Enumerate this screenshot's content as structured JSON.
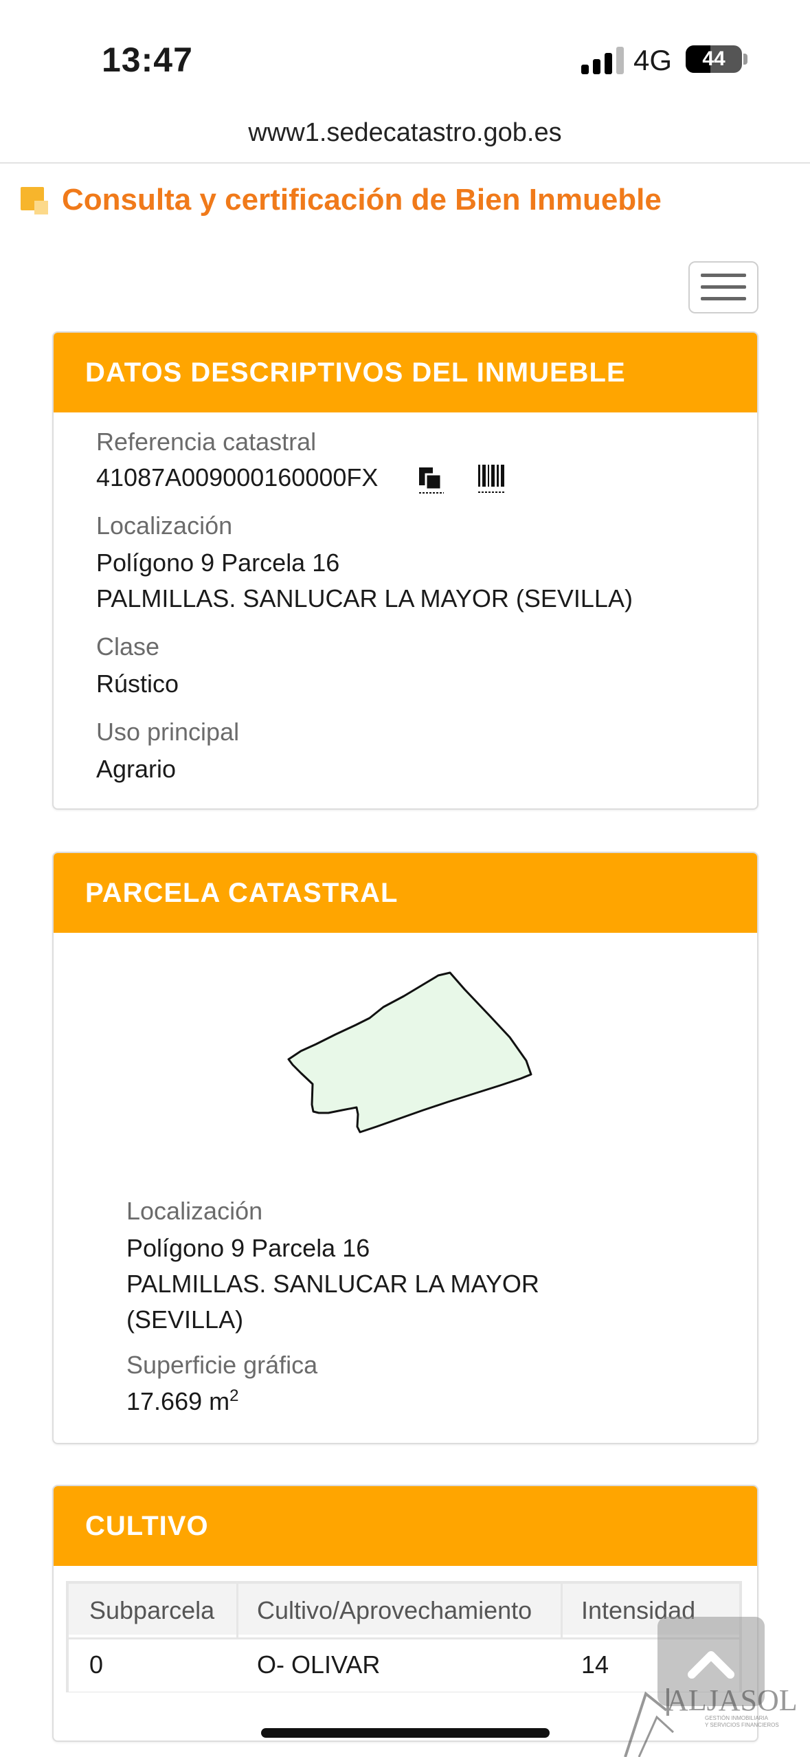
{
  "status": {
    "time": "13:47",
    "network": "4G",
    "battery": "44",
    "battery_level": 0.44
  },
  "browser": {
    "url": "www1.sedecatastro.gob.es"
  },
  "header": {
    "title": "Consulta y certificación de Bien Inmueble",
    "accent_color": "#f07a1a"
  },
  "panel_datos": {
    "title": "DATOS DESCRIPTIVOS DEL INMUEBLE",
    "ref_label": "Referencia catastral",
    "ref_value": "41087A009000160000FX",
    "loc_label": "Localización",
    "loc_line1": "Polígono 9 Parcela 16",
    "loc_line2": "PALMILLAS. SANLUCAR LA MAYOR (SEVILLA)",
    "clase_label": "Clase",
    "clase_value": "Rústico",
    "uso_label": "Uso principal",
    "uso_value": "Agrario"
  },
  "panel_parcela": {
    "title": "PARCELA CATASTRAL",
    "loc_label": "Localización",
    "loc_line1": "Polígono 9 Parcela 16",
    "loc_line2": "PALMILLAS. SANLUCAR LA MAYOR",
    "loc_line3": "(SEVILLA)",
    "sup_label": "Superficie gráfica",
    "sup_value": "17.669 m",
    "sup_unit_exp": "2"
  },
  "panel_cultivo": {
    "title": "CULTIVO",
    "columns": [
      "Subparcela",
      "Cultivo/Aprovechamiento",
      "Intensidad"
    ],
    "rows": [
      [
        "0",
        "O- OLIVAR",
        "14"
      ]
    ]
  },
  "watermark": {
    "brand": "ALJASOL",
    "tagline": "GESTIÓN INMOBILIARIA Y SERVICIOS FINANCIEROS"
  },
  "colors": {
    "panel_header": "#ffa500",
    "parcel_fill": "#e8f8e8",
    "title_orange": "#f07a1a"
  },
  "icons": {
    "copy": "copy-icon",
    "barcode": "barcode-icon",
    "menu": "hamburger-menu-icon",
    "scroll_top": "chevron-up-icon"
  }
}
